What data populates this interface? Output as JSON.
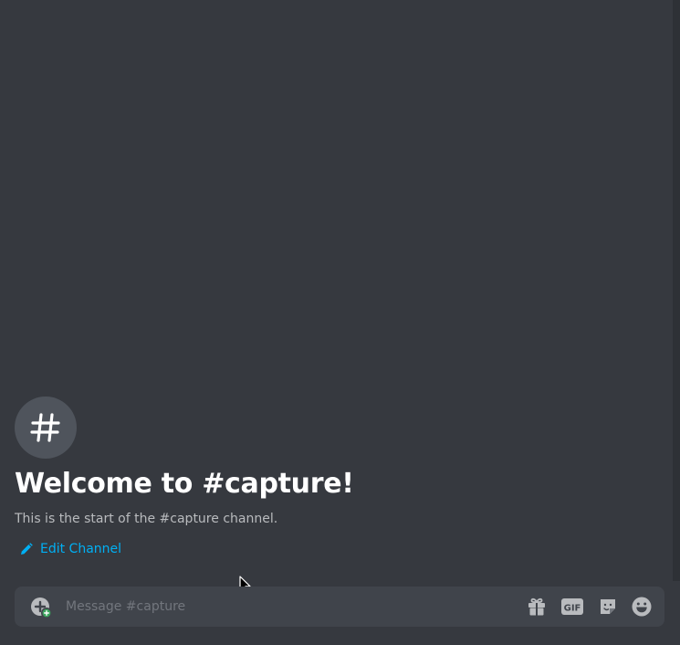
{
  "channel": {
    "name": "capture",
    "hash_symbol": "#"
  },
  "welcome": {
    "title": "Welcome to #capture!",
    "subtitle": "This is the start of the #capture channel."
  },
  "actions": {
    "edit_channel_label": "Edit Channel"
  },
  "composer": {
    "placeholder": "Message #capture",
    "value": "",
    "buttons": {
      "gift_icon": "gift-icon",
      "gif_label": "GIF",
      "sticker_icon": "sticker-icon",
      "emoji_icon": "emoji-icon",
      "attach_icon": "attach-plus-icon"
    }
  },
  "colors": {
    "background": "#36393f",
    "composer_bg": "#40444b",
    "link": "#00b0f4",
    "title": "#ffffff",
    "subtitle": "#b9bbbe",
    "icon": "#b9bbbe",
    "attach_badge": "#3ba55d"
  }
}
